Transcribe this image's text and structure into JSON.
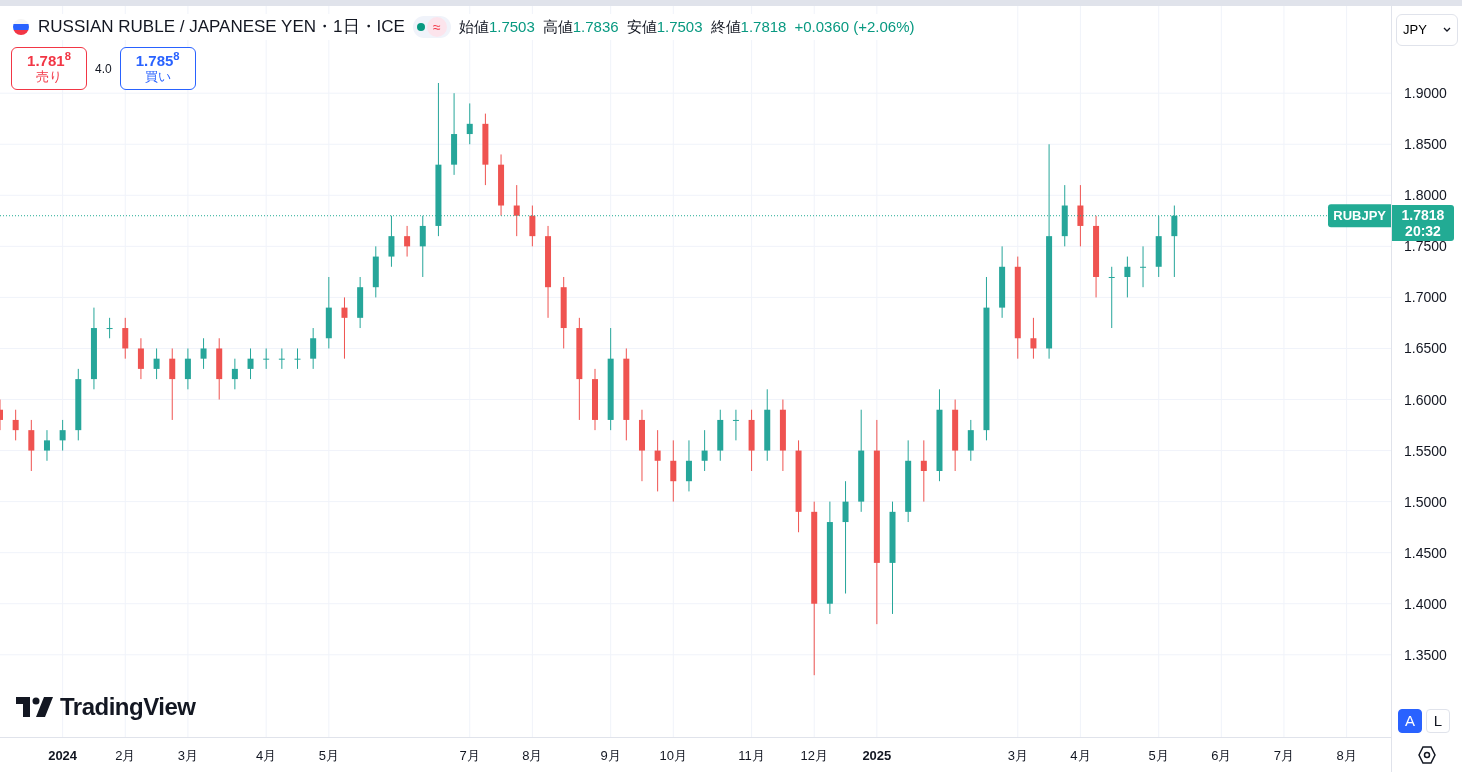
{
  "header": {
    "title": "RUSSIAN RUBLE / JAPANESE YEN・1日・ICE",
    "market_open": true,
    "delay_mark": "≈",
    "ohlc": [
      {
        "label": "始値",
        "value": "1.7503"
      },
      {
        "label": "高値",
        "value": "1.7836"
      },
      {
        "label": "安値",
        "value": "1.7503"
      },
      {
        "label": "終値",
        "value": "1.7818"
      }
    ],
    "change": "+0.0360 (+2.06%)"
  },
  "trade": {
    "sell": {
      "price": "1.781$^{8}$",
      "label": "売り"
    },
    "spread": "4.0",
    "buy": {
      "price": "1.785$^{8}$",
      "label": "買い"
    }
  },
  "currency_menu": {
    "value": "JPY"
  },
  "price_label": {
    "symbol": "RUBJPY",
    "price": "1.7818",
    "countdown": "20:32"
  },
  "logo": "TradingView",
  "scale_buttons": [
    {
      "label": "A",
      "selected": true
    },
    {
      "label": "L",
      "selected": false
    }
  ],
  "chart_data": {
    "type": "candlestick",
    "grid": true,
    "ylim": [
      1.2685,
      1.9854
    ],
    "categories": [
      null,
      null,
      null,
      null,
      "2024",
      null,
      null,
      null,
      "2月",
      null,
      null,
      null,
      "3月",
      null,
      null,
      null,
      null,
      "4月",
      null,
      null,
      null,
      "5月",
      null,
      null,
      null,
      null,
      null,
      null,
      null,
      null,
      "7月",
      null,
      null,
      null,
      "8月",
      null,
      null,
      null,
      null,
      "9月",
      null,
      null,
      null,
      "10月",
      null,
      null,
      null,
      null,
      "11月",
      null,
      null,
      null,
      "12月",
      null,
      null,
      null,
      "2025",
      null,
      null,
      null,
      null,
      null,
      null,
      null,
      null,
      "3月",
      null,
      null,
      null,
      "4月",
      null,
      null,
      null,
      null,
      "5月",
      null,
      null,
      null,
      "6月",
      null,
      null,
      null,
      "7月",
      null,
      null,
      null,
      "8月",
      null
    ],
    "yticks": [
      {
        "value": 1.35,
        "label": "1.3500"
      },
      {
        "value": 1.4,
        "label": "1.4000"
      },
      {
        "value": 1.45,
        "label": "1.4500"
      },
      {
        "value": 1.5,
        "label": "1.5000"
      },
      {
        "value": 1.55,
        "label": "1.5500"
      },
      {
        "value": 1.6,
        "label": "1.6000"
      },
      {
        "value": 1.65,
        "label": "1.6500"
      },
      {
        "value": 1.7,
        "label": "1.7000"
      },
      {
        "value": 1.75,
        "label": "1.7500"
      },
      {
        "value": 1.8,
        "label": "1.8000"
      },
      {
        "value": 1.85,
        "label": "1.8500"
      },
      {
        "value": 1.9,
        "label": "1.9000"
      }
    ],
    "ohlc": [
      [
        1.59,
        1.6,
        1.57,
        1.58
      ],
      [
        1.58,
        1.59,
        1.56,
        1.57
      ],
      [
        1.57,
        1.58,
        1.53,
        1.55
      ],
      [
        1.55,
        1.57,
        1.54,
        1.56
      ],
      [
        1.56,
        1.58,
        1.55,
        1.57
      ],
      [
        1.57,
        1.63,
        1.56,
        1.62
      ],
      [
        1.62,
        1.69,
        1.61,
        1.67
      ],
      [
        1.67,
        1.68,
        1.66,
        1.67
      ],
      [
        1.67,
        1.68,
        1.64,
        1.65
      ],
      [
        1.65,
        1.66,
        1.62,
        1.63
      ],
      [
        1.63,
        1.65,
        1.62,
        1.64
      ],
      [
        1.64,
        1.65,
        1.58,
        1.62
      ],
      [
        1.62,
        1.65,
        1.61,
        1.64
      ],
      [
        1.64,
        1.66,
        1.63,
        1.65
      ],
      [
        1.65,
        1.66,
        1.6,
        1.62
      ],
      [
        1.62,
        1.64,
        1.61,
        1.63
      ],
      [
        1.63,
        1.65,
        1.62,
        1.64
      ],
      [
        1.64,
        1.65,
        1.63,
        1.64
      ],
      [
        1.64,
        1.65,
        1.63,
        1.64
      ],
      [
        1.64,
        1.65,
        1.63,
        1.64
      ],
      [
        1.64,
        1.67,
        1.63,
        1.66
      ],
      [
        1.66,
        1.72,
        1.65,
        1.69
      ],
      [
        1.69,
        1.7,
        1.64,
        1.68
      ],
      [
        1.68,
        1.72,
        1.67,
        1.71
      ],
      [
        1.71,
        1.75,
        1.7,
        1.74
      ],
      [
        1.74,
        1.78,
        1.73,
        1.76
      ],
      [
        1.76,
        1.77,
        1.74,
        1.75
      ],
      [
        1.75,
        1.78,
        1.72,
        1.77
      ],
      [
        1.77,
        1.91,
        1.76,
        1.83
      ],
      [
        1.83,
        1.9,
        1.82,
        1.86
      ],
      [
        1.86,
        1.89,
        1.85,
        1.87
      ],
      [
        1.87,
        1.88,
        1.81,
        1.83
      ],
      [
        1.83,
        1.84,
        1.78,
        1.79
      ],
      [
        1.79,
        1.81,
        1.76,
        1.78
      ],
      [
        1.78,
        1.79,
        1.75,
        1.76
      ],
      [
        1.76,
        1.77,
        1.68,
        1.71
      ],
      [
        1.71,
        1.72,
        1.65,
        1.67
      ],
      [
        1.67,
        1.68,
        1.58,
        1.62
      ],
      [
        1.62,
        1.63,
        1.57,
        1.58
      ],
      [
        1.58,
        1.67,
        1.57,
        1.64
      ],
      [
        1.64,
        1.65,
        1.56,
        1.58
      ],
      [
        1.58,
        1.59,
        1.52,
        1.55
      ],
      [
        1.55,
        1.57,
        1.51,
        1.54
      ],
      [
        1.54,
        1.56,
        1.5,
        1.52
      ],
      [
        1.52,
        1.56,
        1.51,
        1.54
      ],
      [
        1.54,
        1.57,
        1.53,
        1.55
      ],
      [
        1.55,
        1.59,
        1.54,
        1.58
      ],
      [
        1.58,
        1.59,
        1.56,
        1.58
      ],
      [
        1.58,
        1.59,
        1.53,
        1.55
      ],
      [
        1.55,
        1.61,
        1.54,
        1.59
      ],
      [
        1.59,
        1.6,
        1.53,
        1.55
      ],
      [
        1.55,
        1.56,
        1.47,
        1.49
      ],
      [
        1.49,
        1.5,
        1.33,
        1.4
      ],
      [
        1.4,
        1.5,
        1.39,
        1.48
      ],
      [
        1.48,
        1.52,
        1.41,
        1.5
      ],
      [
        1.5,
        1.59,
        1.49,
        1.55
      ],
      [
        1.55,
        1.58,
        1.38,
        1.44
      ],
      [
        1.44,
        1.5,
        1.39,
        1.49
      ],
      [
        1.49,
        1.56,
        1.48,
        1.54
      ],
      [
        1.54,
        1.56,
        1.5,
        1.53
      ],
      [
        1.53,
        1.61,
        1.52,
        1.59
      ],
      [
        1.59,
        1.6,
        1.53,
        1.55
      ],
      [
        1.55,
        1.58,
        1.54,
        1.57
      ],
      [
        1.57,
        1.72,
        1.56,
        1.69
      ],
      [
        1.69,
        1.75,
        1.68,
        1.73
      ],
      [
        1.73,
        1.74,
        1.64,
        1.66
      ],
      [
        1.66,
        1.68,
        1.64,
        1.65
      ],
      [
        1.65,
        1.85,
        1.64,
        1.76
      ],
      [
        1.76,
        1.81,
        1.75,
        1.79
      ],
      [
        1.79,
        1.81,
        1.75,
        1.77
      ],
      [
        1.77,
        1.78,
        1.7,
        1.72
      ],
      [
        1.72,
        1.73,
        1.67,
        1.72
      ],
      [
        1.72,
        1.74,
        1.7,
        1.73
      ],
      [
        1.73,
        1.75,
        1.71,
        1.73
      ],
      [
        1.73,
        1.78,
        1.72,
        1.76
      ],
      [
        1.76,
        1.79,
        1.72,
        1.78
      ],
      null,
      null,
      null,
      null,
      null,
      null,
      null,
      null,
      null,
      null,
      null,
      null
    ],
    "ref_lines": [
      {
        "axis": "y",
        "value": 1.78,
        "color": "#22ab94",
        "line_style": "dotted"
      }
    ]
  }
}
